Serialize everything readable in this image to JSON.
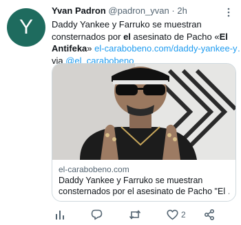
{
  "tweet": {
    "avatar_letter": "Y",
    "author_name": "Yvan Padron",
    "author_handle": "@padron_yvan",
    "separator": "·",
    "time": "2h",
    "text": {
      "line1": "Daddy Yankee y Farruko se muestran",
      "line2_a": "consternados por ",
      "line2_bold": "el",
      "line2_b": " asesinato de Pacho «",
      "line2_bold2": "El",
      "line3_bold": "Antifeka",
      "line3_a": "» ",
      "line3_link": "el-carabobeno.com/daddy-yankee-y…",
      "line4_a": "via ",
      "line4_link": "@el_carabobeno"
    }
  },
  "card": {
    "domain": "el-carabobeno.com",
    "title_line1": "Daddy Yankee y Farruko se muestran",
    "title_line2": "consternados por el asesinato de Pacho \"El …"
  },
  "actions": {
    "like_count": "2"
  },
  "colors": {
    "link": "#1d9bf0",
    "secondary": "#536471",
    "avatar_bg": "#1e6b5e",
    "border": "#cfd9de"
  },
  "icons": [
    "more-icon",
    "analytics-icon",
    "reply-icon",
    "retweet-icon",
    "like-icon",
    "share-icon"
  ]
}
